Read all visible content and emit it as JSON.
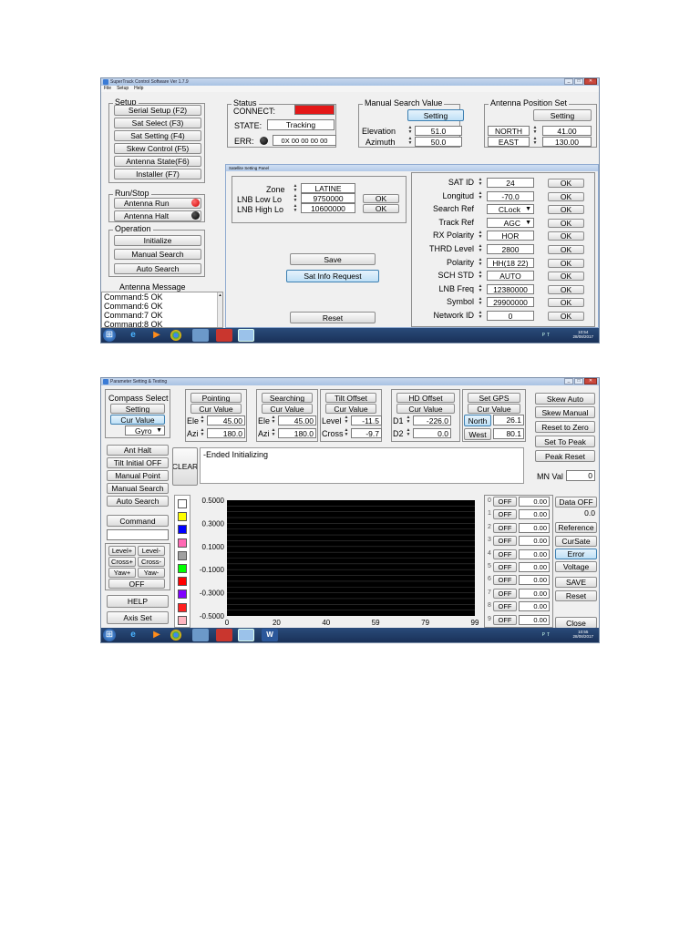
{
  "win1": {
    "title": "SuperTrack Control Software Ver 1.7.9",
    "menu": [
      "File",
      "Setup",
      "Help"
    ],
    "setup": {
      "title": "Setup",
      "buttons": [
        "Serial Setup (F2)",
        "Sat Select (F3)",
        "Sat Setting (F4)",
        "Skew Control (F5)",
        "Antenna State(F6)",
        "Installer (F7)"
      ]
    },
    "status": {
      "title": "Status",
      "connect_label": "CONNECT:",
      "state_label": "STATE:",
      "state_value": "Tracking",
      "err_label": "ERR:",
      "err_value": "0X 00 00 00 00",
      "connect_color": "#e41818"
    },
    "manual_search": {
      "title": "Manual Search Value",
      "setting": "Setting",
      "elevation_label": "Elevation",
      "elevation": "51.0",
      "azimuth_label": "Azimuth",
      "azimuth": "50.0"
    },
    "antenna_pos": {
      "title": "Antenna Position Set",
      "setting": "Setting",
      "north_label": "NORTH",
      "north": "41.00",
      "east_label": "EAST",
      "east": "130.00"
    },
    "runstop": {
      "title": "Run/Stop",
      "run": "Antenna Run",
      "halt": "Antenna Halt"
    },
    "operation": {
      "title": "Operation",
      "buttons": [
        "Initialize",
        "Manual Search",
        "Auto Search"
      ]
    },
    "message": {
      "title": "Antenna Message",
      "lines": [
        "Command:5 OK",
        "Command:6 OK",
        "Command:7 OK",
        "Command:8 OK"
      ]
    },
    "panel": {
      "title": "Satellite Setting Panel",
      "zone_label": "Zone",
      "zone": "LATINE",
      "lnb_low_label": "LNB Low Lo",
      "lnb_low": "9750000",
      "lnb_high_label": "LNB High Lo",
      "lnb_high": "10600000",
      "ok": "OK",
      "save": "Save",
      "sat_info": "Sat Info Request",
      "reset": "Reset",
      "right": [
        {
          "label": "SAT ID",
          "value": "24"
        },
        {
          "label": "Longitud",
          "value": "-70.0"
        },
        {
          "label": "Search Ref",
          "value": "CLock"
        },
        {
          "label": "Track Ref",
          "value": "AGC"
        },
        {
          "label": "RX Polarity",
          "value": "HOR"
        },
        {
          "label": "THRD Level",
          "value": "2800"
        },
        {
          "label": "Polarity",
          "value": "HH(18 22)"
        },
        {
          "label": "SCH STD",
          "value": "AUTO"
        },
        {
          "label": "LNB Freq",
          "value": "12380000"
        },
        {
          "label": "Symbol",
          "value": "29900000"
        },
        {
          "label": "Network ID",
          "value": "0"
        }
      ]
    },
    "clock": {
      "time": "10:54",
      "date": "28/08/2017"
    },
    "tray": "PT"
  },
  "win2": {
    "title": "Parameter Setting & Testing",
    "compass": {
      "title": "Compass Select",
      "setting": "Setting",
      "cur_value": "Cur Value",
      "gyro": "Gyro"
    },
    "groups": [
      {
        "title": "Pointing",
        "cur": "Cur Value",
        "r1_label": "Ele",
        "r1": "45.00",
        "r2_label": "Azi",
        "r2": "180.0"
      },
      {
        "title": "Searching",
        "cur": "Cur Value",
        "r1_label": "Ele",
        "r1": "45.00",
        "r2_label": "Azi",
        "r2": "180.0"
      },
      {
        "title": "Tilt Offset",
        "cur": "Cur Value",
        "r1_label": "Level",
        "r1": "-11.5",
        "r2_label": "Cross",
        "r2": "-9.7"
      },
      {
        "title": "HD Offset",
        "cur": "Cur Value",
        "r1_label": "D1",
        "r1": "-226.0",
        "r2_label": "D2",
        "r2": "0.0"
      }
    ],
    "gps": {
      "title": "Set GPS",
      "cur": "Cur Value",
      "north": "North",
      "north_v": "26.1",
      "west": "West",
      "west_v": "80.1"
    },
    "right_btns": [
      "Skew Auto",
      "Skew Manual",
      "Reset to Zero",
      "Set To Peak",
      "Peak Reset"
    ],
    "mn_label": "MN Val",
    "mn": "0",
    "left_btns": [
      "Ant Halt",
      "Tilt Initial OFF",
      "Manual Point",
      "Manual Search",
      "Auto Search"
    ],
    "command": "Command",
    "level_btns": [
      "Level+",
      "Level-",
      "Cross+",
      "Cross-",
      "Yaw+",
      "Yaw-"
    ],
    "off": "OFF",
    "help": "HELP",
    "axis": "Axis Set",
    "clear": "CLEAR",
    "log": "-Ended Initializing",
    "swatches": [
      "#ffffff",
      "#ffff00",
      "#0000ff",
      "#ff69b4",
      "#a0a0a0",
      "#00ff00",
      "#ff0000",
      "#8000ff",
      "#ff2020",
      "#ffb6c1"
    ],
    "channels": [
      {
        "id": "0",
        "state": "OFF",
        "val": "0.00"
      },
      {
        "id": "1",
        "state": "OFF",
        "val": "0.00"
      },
      {
        "id": "2",
        "state": "OFF",
        "val": "0.00"
      },
      {
        "id": "3",
        "state": "OFF",
        "val": "0.00"
      },
      {
        "id": "4",
        "state": "OFF",
        "val": "0.00"
      },
      {
        "id": "5",
        "state": "OFF",
        "val": "0.00"
      },
      {
        "id": "6",
        "state": "OFF",
        "val": "0.00"
      },
      {
        "id": "7",
        "state": "OFF",
        "val": "0.00"
      },
      {
        "id": "8",
        "state": "OFF",
        "val": "0.00"
      },
      {
        "id": "9",
        "state": "OFF",
        "val": "0.00"
      }
    ],
    "data_off": "Data OFF",
    "data_val": "0.0",
    "side_btns": [
      "Reference",
      "CurSate",
      "Error",
      "Voltage",
      "SAVE",
      "Reset"
    ],
    "close": "Close",
    "clock": {
      "time": "10:55",
      "date": "28/08/2017"
    },
    "tray": "PT"
  },
  "chart_data": {
    "type": "line",
    "yticks": [
      "0.5000",
      "0.3000",
      "0.1000",
      "-0.1000",
      "-0.3000",
      "-0.5000"
    ],
    "xticks": [
      "0",
      "20",
      "40",
      "59",
      "79",
      "99"
    ],
    "ylim": [
      -0.5,
      0.5
    ],
    "xlim": [
      0,
      99
    ],
    "series": [],
    "background": "#000000",
    "grid": true
  }
}
